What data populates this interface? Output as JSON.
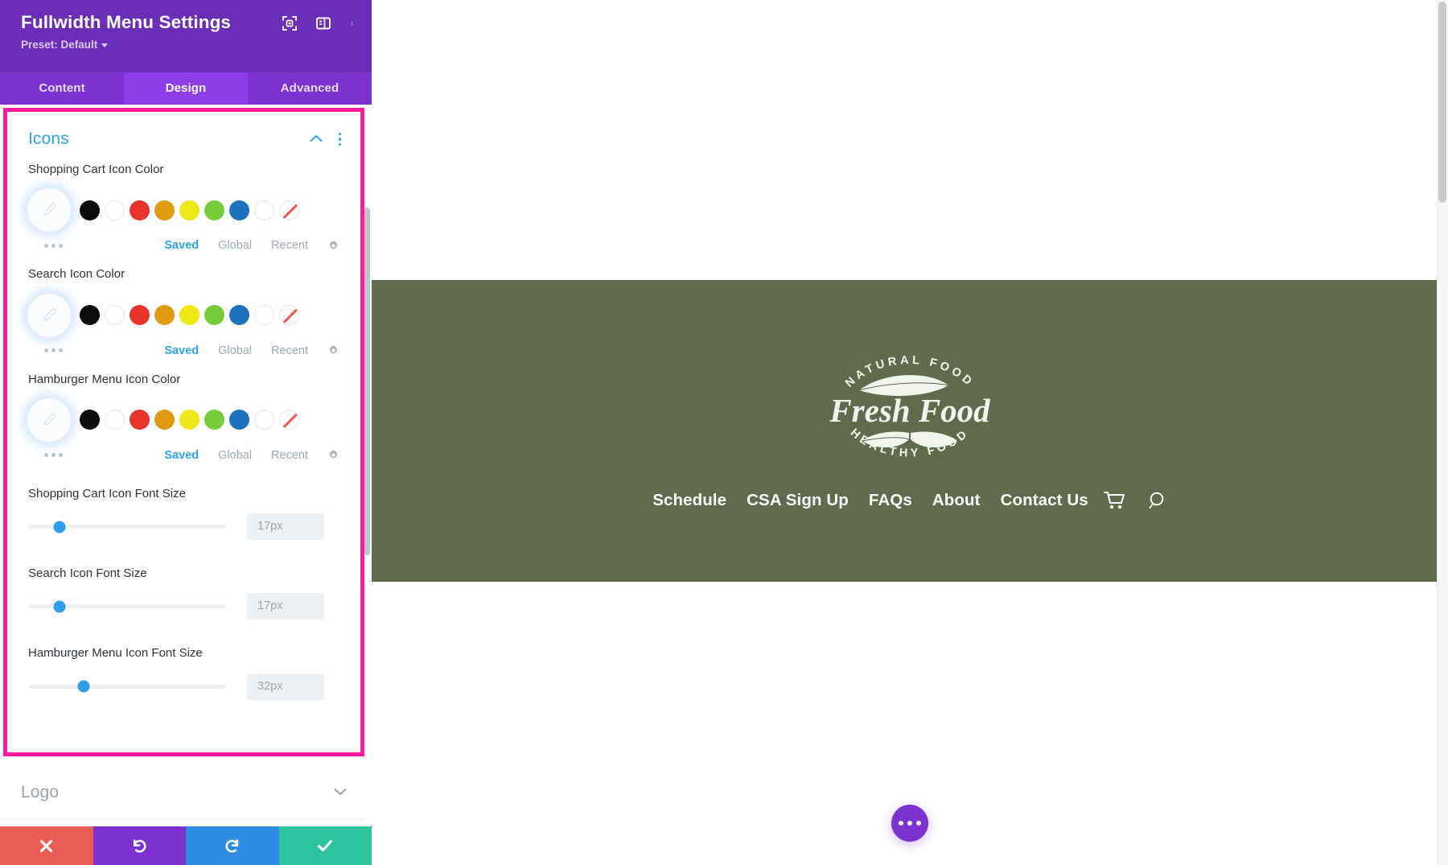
{
  "panel": {
    "title": "Fullwidth Menu Settings",
    "preset_label": "Preset: Default",
    "header_icons": [
      {
        "name": "focus-target-icon"
      },
      {
        "name": "panel-layout-icon"
      },
      {
        "name": "more-options-icon"
      }
    ],
    "tabs": [
      {
        "label": "Content",
        "active": false
      },
      {
        "label": "Design",
        "active": true
      },
      {
        "label": "Advanced",
        "active": false
      }
    ],
    "sections": {
      "icons": {
        "title": "Icons",
        "expanded": true,
        "fields": {
          "shopping_cart_color": {
            "label": "Shopping Cart Icon Color",
            "swatches": [
              "#0B0B0B",
              "#FFFFFF",
              "#E8342A",
              "#E09A12",
              "#EFE817",
              "#76CC3A",
              "#1E73BE",
              "#FFFFFF",
              "none"
            ]
          },
          "search_color": {
            "label": "Search Icon Color",
            "swatches": [
              "#0B0B0B",
              "#FFFFFF",
              "#E8342A",
              "#E09A12",
              "#EFE817",
              "#76CC3A",
              "#1E73BE",
              "#FFFFFF",
              "none"
            ]
          },
          "hamburger_color": {
            "label": "Hamburger Menu Icon Color",
            "swatches": [
              "#0B0B0B",
              "#FFFFFF",
              "#E8342A",
              "#E09A12",
              "#EFE817",
              "#76CC3A",
              "#1E73BE",
              "#FFFFFF",
              "none"
            ]
          },
          "shopping_cart_size": {
            "label": "Shopping Cart Icon Font Size",
            "value": "17px",
            "slider_percent": 16
          },
          "search_size": {
            "label": "Search Icon Font Size",
            "value": "17px",
            "slider_percent": 16
          },
          "hamburger_size": {
            "label": "Hamburger Menu Icon Font Size",
            "value": "32px",
            "slider_percent": 28
          }
        },
        "palette_tabs": [
          {
            "label": "Saved",
            "active": true
          },
          {
            "label": "Global",
            "active": false
          },
          {
            "label": "Recent",
            "active": false
          }
        ]
      },
      "logo": {
        "title": "Logo",
        "expanded": false
      }
    },
    "actions": [
      {
        "name": "cancel-button",
        "icon": "close-icon",
        "color": "#EB5C54"
      },
      {
        "name": "undo-button",
        "icon": "undo-icon",
        "color": "#7B32CE"
      },
      {
        "name": "redo-button",
        "icon": "redo-icon",
        "color": "#2E8DE0"
      },
      {
        "name": "save-button",
        "icon": "check-icon",
        "color": "#2DC4A0"
      }
    ]
  },
  "preview": {
    "hero_background": "#606B4E",
    "logo": {
      "top_arc": "NATURAL FOOD",
      "script": "Fresh Food",
      "bottom_arc": "HEALTHY FOOD"
    },
    "nav_items": [
      {
        "label": "Schedule"
      },
      {
        "label": "CSA Sign Up"
      },
      {
        "label": "FAQs"
      },
      {
        "label": "About"
      },
      {
        "label": "Contact Us"
      }
    ],
    "nav_icons": [
      {
        "name": "shopping-cart-icon"
      },
      {
        "name": "search-icon"
      }
    ],
    "fab": {
      "name": "page-settings-fab",
      "icon": "ellipsis-icon",
      "color": "#7B32CE"
    }
  }
}
